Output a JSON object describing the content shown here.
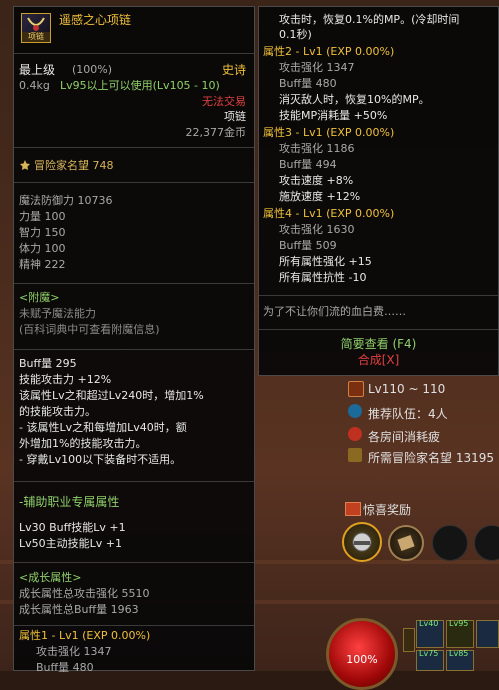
{
  "item": {
    "icon_tag": "项链",
    "name": "遥感之心项链",
    "grade": "最上级",
    "grade_pct": "(100%)",
    "rarity": "史诗",
    "weight": "0.4kg",
    "level_req": "Lv95以上可以使用(Lv105 - 10)",
    "trade": "无法交易",
    "type": "项链",
    "price": "22,377金币"
  },
  "fame": "冒险家名望 748",
  "stats": [
    "魔法防御力 10736",
    "力量 100",
    "智力 150",
    "体力 100",
    "精神 222"
  ],
  "enchant": {
    "title": "<附魔>",
    "line1": "未赋予魔法能力",
    "line2": "(百科词典中可查看附魔信息)"
  },
  "effects": [
    "Buff量 295",
    "技能攻击力 +12%",
    "该属性Lv之和超过Lv240时，增加1%",
    "的技能攻击力。",
    "- 该属性Lv之和每增加Lv40时，额",
    "外增加1%的技能攻击力。",
    "- 穿戴Lv100以下装备时不适用。"
  ],
  "support": {
    "title": "-辅助职业专属属性",
    "lines": [
      "Lv30 Buff技能Lv +1",
      "Lv50主动技能Lv +1"
    ]
  },
  "growth": {
    "title": "<成长属性>",
    "lines": [
      "成长属性总攻击强化 5510",
      "成长属性总Buff量 1963"
    ]
  },
  "attr1": {
    "title": "属性1 - Lv1 (EXP 0.00%)",
    "lines": [
      "攻击强化 1347",
      "Buff量 480"
    ]
  },
  "right": {
    "top_lines": [
      "攻击时，恢复0.1%的MP。(冷却时间",
      "0.1秒)"
    ],
    "attr2_title": "属性2 - Lv1 (EXP 0.00%)",
    "attr2_lines": [
      "攻击强化 1347",
      "Buff量 480",
      "消灭敌人时，恢复10%的MP。",
      "技能MP消耗量 +50%"
    ],
    "attr3_title": "属性3 - Lv1 (EXP 0.00%)",
    "attr3_lines": [
      "攻击强化 1186",
      "Buff量 494",
      "攻击速度 +8%",
      "施放速度 +12%"
    ],
    "attr4_title": "属性4 - Lv1 (EXP 0.00%)",
    "attr4_lines": [
      "攻击强化 1630",
      "Buff量 509",
      "所有属性强化 +15",
      "所有属性抗性 -10"
    ],
    "flavor": "为了不让你们流的血白费……",
    "brief": "简要查看 (F4)",
    "synth": "合成[X]"
  },
  "game_ui": {
    "level_range": "Lv110 ~ 110",
    "recommend": "推荐队伍：4人",
    "fatigue": "各房间消耗疲",
    "fame_req": "所需冒险家名望 13195",
    "reward": "惊喜奖励",
    "hp": "100%",
    "slot_lv1": "Lv40",
    "slot_lv2": "Lv95",
    "slot_lv3": "Lv75",
    "slot_lv4": "Lv85"
  }
}
